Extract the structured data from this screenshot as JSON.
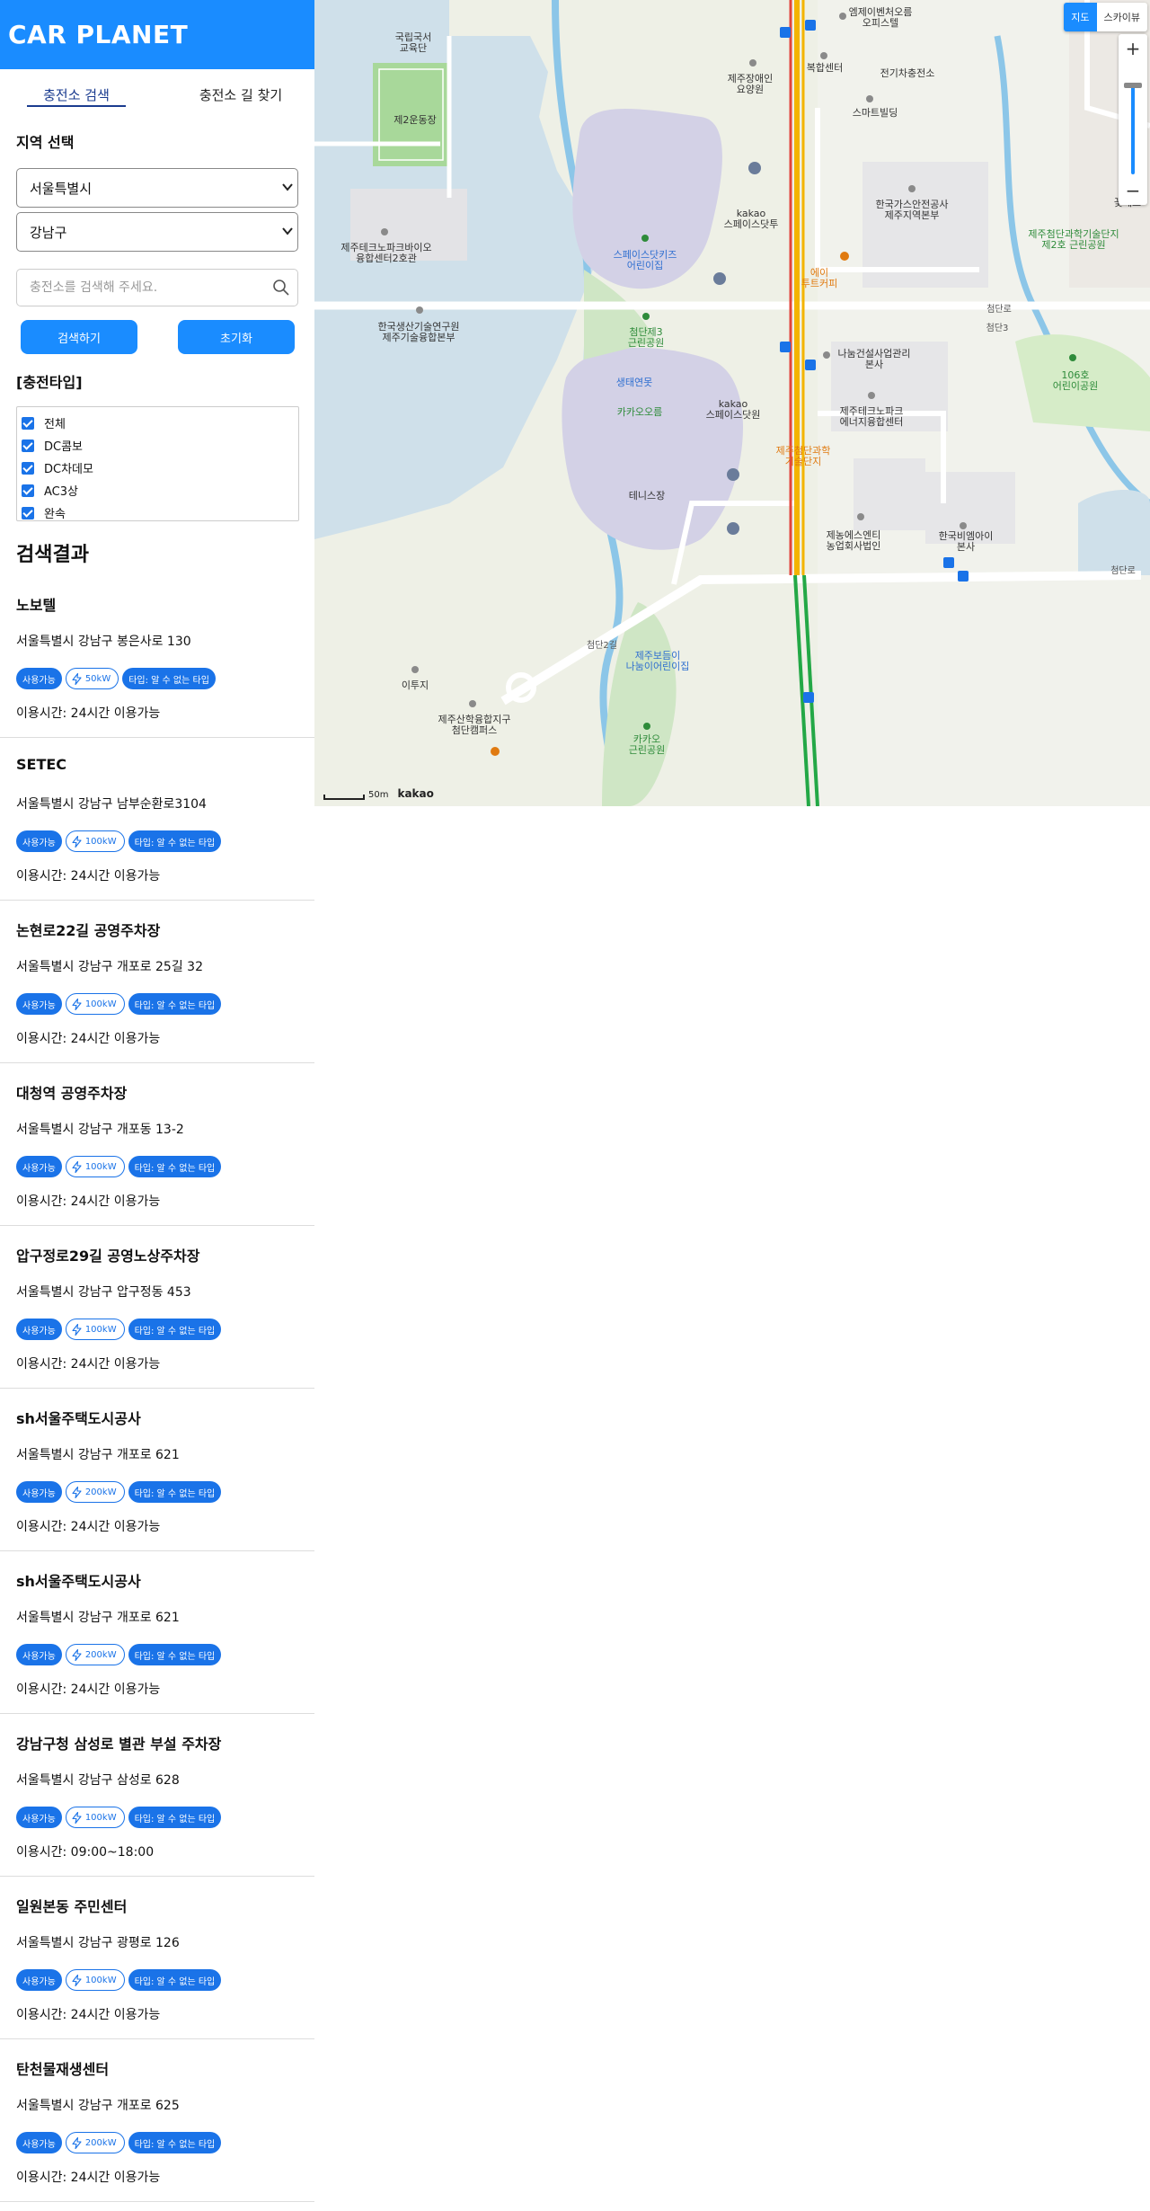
{
  "brand": "CAR PLANET",
  "tabs": {
    "search": "충전소 검색",
    "route": "충전소 길 찾기"
  },
  "region": {
    "title": "지역 선택",
    "city": "서울특별시",
    "district": "강남구"
  },
  "search": {
    "placeholder": "충전소를 검색해 주세요.",
    "value": ""
  },
  "buttons": {
    "search": "검색하기",
    "reset": "초기화"
  },
  "charger_types": {
    "title": "[충전타입]",
    "options": [
      {
        "label": "전체",
        "checked": true
      },
      {
        "label": "DC콤보",
        "checked": true
      },
      {
        "label": "DC차데모",
        "checked": true
      },
      {
        "label": "AC3상",
        "checked": true
      },
      {
        "label": "완속",
        "checked": true
      }
    ]
  },
  "results": {
    "title": "검색결과",
    "items": [
      {
        "name": "노보텔",
        "address": "서울특별시 강남구 봉은사로 130",
        "status": "사용가능",
        "power": "50kW",
        "type": "타입: 알 수 없는 타입",
        "hours": "이용시간: 24시간 이용가능"
      },
      {
        "name": "SETEC",
        "address": "서울특별시 강남구 남부순환로3104",
        "status": "사용가능",
        "power": "100kW",
        "type": "타입: 알 수 없는 타입",
        "hours": "이용시간: 24시간 이용가능"
      },
      {
        "name": "논현로22길 공영주차장",
        "address": "서울특별시 강남구 개포로 25길 32",
        "status": "사용가능",
        "power": "100kW",
        "type": "타입: 알 수 없는 타입",
        "hours": "이용시간: 24시간 이용가능"
      },
      {
        "name": "대청역 공영주차장",
        "address": "서울특별시 강남구 개포동 13-2",
        "status": "사용가능",
        "power": "100kW",
        "type": "타입: 알 수 없는 타입",
        "hours": "이용시간: 24시간 이용가능"
      },
      {
        "name": "압구정로29길 공영노상주차장",
        "address": "서울특별시 강남구 압구정동 453",
        "status": "사용가능",
        "power": "100kW",
        "type": "타입: 알 수 없는 타입",
        "hours": "이용시간: 24시간 이용가능"
      },
      {
        "name": "sh서울주택도시공사",
        "address": "서울특별시 강남구 개포로 621",
        "status": "사용가능",
        "power": "200kW",
        "type": "타입: 알 수 없는 타입",
        "hours": "이용시간: 24시간 이용가능"
      },
      {
        "name": "sh서울주택도시공사",
        "address": "서울특별시 강남구 개포로 621",
        "status": "사용가능",
        "power": "200kW",
        "type": "타입: 알 수 없는 타입",
        "hours": "이용시간: 24시간 이용가능"
      },
      {
        "name": "강남구청 삼성로 별관 부설 주차장",
        "address": "서울특별시 강남구 삼성로 628",
        "status": "사용가능",
        "power": "100kW",
        "type": "타입: 알 수 없는 타입",
        "hours": "이용시간: 09:00~18:00"
      },
      {
        "name": "일원본동 주민센터",
        "address": "서울특별시 강남구 광평로 126",
        "status": "사용가능",
        "power": "100kW",
        "type": "타입: 알 수 없는 타입",
        "hours": "이용시간: 24시간 이용가능"
      },
      {
        "name": "탄천물재생센터",
        "address": "서울특별시 강남구 개포로 625",
        "status": "사용가능",
        "power": "200kW",
        "type": "타입: 알 수 없는 타입",
        "hours": "이용시간: 24시간 이용가능"
      }
    ]
  },
  "map": {
    "type_buttons": {
      "map": "지도",
      "sky": "스카이뷰"
    },
    "zoom_in": "+",
    "zoom_out": "−",
    "scale": "50m",
    "logo": "kakao",
    "labels": [
      {
        "id": "l1",
        "text": "국립국서\n교육단",
        "style": ""
      },
      {
        "id": "l2",
        "text": "제2운동장",
        "style": ""
      },
      {
        "id": "l3",
        "text": "엠제이벤처오름\n오피스텔",
        "style": ""
      },
      {
        "id": "l4",
        "text": "제주장애인\n요양원",
        "style": ""
      },
      {
        "id": "l5",
        "text": "복합센터",
        "style": ""
      },
      {
        "id": "l6",
        "text": "전기차충전소",
        "style": ""
      },
      {
        "id": "l7",
        "text": "스마트빌딩",
        "style": ""
      },
      {
        "id": "l8",
        "text": "kakao\n스페이스닷투",
        "style": ""
      },
      {
        "id": "l9",
        "text": "스페이스닷키즈\n어린이집",
        "style": "blue"
      },
      {
        "id": "l10",
        "text": "한국가스안전공사\n제주지역본부",
        "style": ""
      },
      {
        "id": "l11",
        "text": "제주첨단과학기술단지\n제2호 근린공원",
        "style": "green"
      },
      {
        "id": "l12",
        "text": "제주테크노파크바이오\n융합센터2호관",
        "style": ""
      },
      {
        "id": "l13",
        "text": "에이\n투트커피",
        "style": "orange"
      },
      {
        "id": "l14",
        "text": "첨단로",
        "style": "road"
      },
      {
        "id": "l15",
        "text": "한국생산기술연구원\n제주기술융합본부",
        "style": ""
      },
      {
        "id": "l16",
        "text": "첨단제3\n근린공원",
        "style": "green"
      },
      {
        "id": "l17",
        "text": "나눔건설사업관리\n본사",
        "style": ""
      },
      {
        "id": "l18",
        "text": "106호\n어린이공원",
        "style": "green"
      },
      {
        "id": "l19",
        "text": "생태연못",
        "style": "blue"
      },
      {
        "id": "l20",
        "text": "카카오오름",
        "style": "green"
      },
      {
        "id": "l21",
        "text": "kakao\n스페이스닷원",
        "style": ""
      },
      {
        "id": "l22",
        "text": "제주테크노파크\n에너지융합센터",
        "style": ""
      },
      {
        "id": "l23",
        "text": "제주첨단과학\n기술단지",
        "style": "orange"
      },
      {
        "id": "l24",
        "text": "테니스장",
        "style": ""
      },
      {
        "id": "l25",
        "text": "제농에스엔티\n농업회사법인",
        "style": ""
      },
      {
        "id": "l26",
        "text": "한국비엠아이\n본사",
        "style": ""
      },
      {
        "id": "l27",
        "text": "제주보듬이\n나눔이어린이집",
        "style": "blue"
      },
      {
        "id": "l28",
        "text": "이투지",
        "style": ""
      },
      {
        "id": "l29",
        "text": "제주산학융합지구\n첨단캠퍼스",
        "style": ""
      },
      {
        "id": "l30",
        "text": "카카오\n근린공원",
        "style": "green"
      },
      {
        "id": "l31",
        "text": "첨단로",
        "style": "road"
      },
      {
        "id": "l32",
        "text": "첨단2길",
        "style": "road"
      },
      {
        "id": "l33",
        "text": "첨단3",
        "style": "road"
      },
      {
        "id": "l34",
        "text": "제주\n꽃예르",
        "style": ""
      }
    ]
  }
}
